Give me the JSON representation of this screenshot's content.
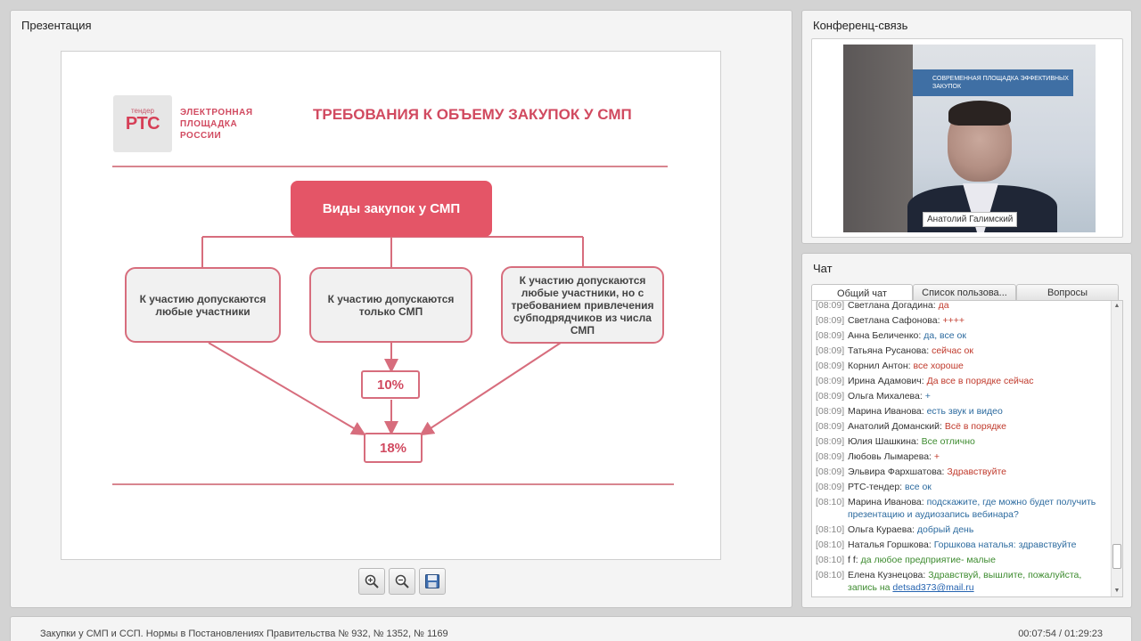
{
  "presentation": {
    "panel_title": "Презентация",
    "slide": {
      "logo_small": "тендер",
      "logo_big": "РТС",
      "logo_text": "ЭЛЕКТРОННАЯ\nПЛОЩАДКА\nРОССИИ",
      "title": "ТРЕБОВАНИЯ К ОБЪЕМУ ЗАКУПОК У СМП",
      "main_box": "Виды закупок у СМП",
      "box_left": "К участию допускаются любые участники",
      "box_center": "К участию допускаются только СМП",
      "box_right": "К участию допускаются любые участники, но с требованием привлечения субподрядчиков из числа СМП",
      "pct_10": "10%",
      "pct_18": "18%",
      "accent_color": "#e45567"
    },
    "toolbar": {
      "zoom_in_icon": "zoom-in-icon",
      "zoom_out_icon": "zoom-out-icon",
      "save_icon": "save-icon"
    }
  },
  "conference": {
    "panel_title": "Конференц-связь",
    "speaker_name": "Анатолий Галимский",
    "banner_text": "СОВРЕМЕННАЯ ПЛОЩАДКА ЭФФЕКТИВНЫХ ЗАКУПОК"
  },
  "chat": {
    "panel_title": "Чат",
    "tabs": [
      "Общий чат",
      "Список пользова...",
      "Вопросы"
    ],
    "active_tab": 0,
    "messages": [
      {
        "time": "[08:09]",
        "name": "Светлана Догадина:",
        "text": "да",
        "color": "red"
      },
      {
        "time": "[08:09]",
        "name": "Светлана Сафонова:",
        "text": "++++",
        "color": "red"
      },
      {
        "time": "[08:09]",
        "name": "Анна Беличенко:",
        "text": "да, все ок",
        "color": "blue"
      },
      {
        "time": "[08:09]",
        "name": "Татьяна Русанова:",
        "text": "сейчас ок",
        "color": "red"
      },
      {
        "time": "[08:09]",
        "name": "Корнил Антон:",
        "text": "все хороше",
        "color": "red"
      },
      {
        "time": "[08:09]",
        "name": "Ирина Адамович:",
        "text": "Да все в порядке сейчас",
        "color": "red"
      },
      {
        "time": "[08:09]",
        "name": "Ольга Михалева:",
        "text": "+",
        "color": "blue"
      },
      {
        "time": "[08:09]",
        "name": "Марина Иванова:",
        "text": "есть звук и видео",
        "color": "blue"
      },
      {
        "time": "[08:09]",
        "name": "Анатолий Доманский:",
        "text": "Всё в порядке",
        "color": "red"
      },
      {
        "time": "[08:09]",
        "name": "Юлия Шашкина:",
        "text": "Все отлично",
        "color": "green"
      },
      {
        "time": "[08:09]",
        "name": "Любовь Лымарева:",
        "text": "+",
        "color": "red"
      },
      {
        "time": "[08:09]",
        "name": "Эльвира Фархшатова:",
        "text": "Здравствуйте",
        "color": "red"
      },
      {
        "time": "[08:09]",
        "name": "РТС-тендер:",
        "text": "все ок",
        "color": "blue"
      },
      {
        "time": "[08:10]",
        "name": "Марина Иванова:",
        "text": "подскажите, где можно будет получить презентацию и аудиозапись вебинара?",
        "color": "blue"
      },
      {
        "time": "[08:10]",
        "name": "Ольга Кураева:",
        "text": "добрый день",
        "color": "blue"
      },
      {
        "time": "[08:10]",
        "name": "Наталья Горшкова:",
        "text": "Горшкова наталья: здравствуйте",
        "color": "blue"
      },
      {
        "time": "[08:10]",
        "name": "f f:",
        "text": "да любое предприятие- малые",
        "color": "green"
      },
      {
        "time": "[08:10]",
        "name": "Елена Кузнецова:",
        "text": "Здравствуй, вышлите, пожалуйста, запись на ",
        "color": "green",
        "link": "detsad373@mail.ru"
      }
    ]
  },
  "footer": {
    "title": "Закупки у СМП и ССП. Нормы в Постановлениях Правительства № 932, № 1352, № 1169",
    "time": "00:07:54 / 01:29:23"
  }
}
